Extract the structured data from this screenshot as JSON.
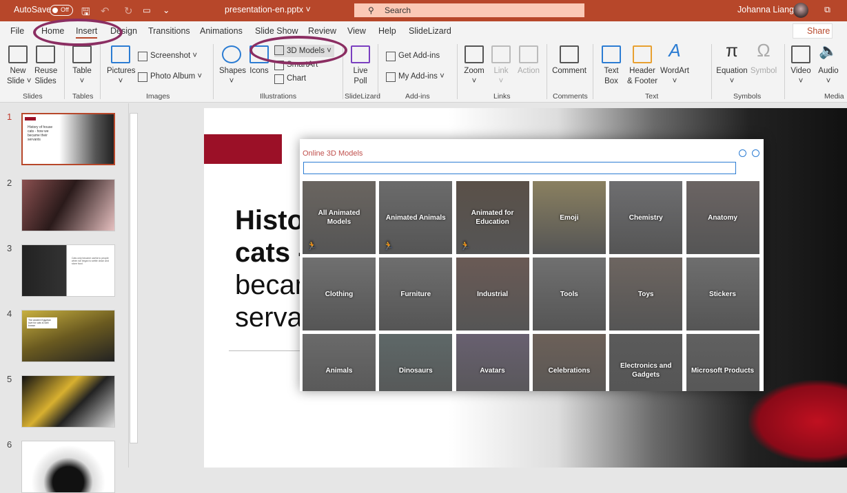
{
  "titlebar": {
    "autosave": "AutoSave",
    "toggle": "Off",
    "filename": "presentation-en.pptx ˅",
    "search": "Search",
    "user": "Johanna Liang"
  },
  "tabs": [
    "File",
    "Home",
    "Insert",
    "Design",
    "Transitions",
    "Animations",
    "Slide Show",
    "Review",
    "View",
    "Help",
    "SlideLizard"
  ],
  "active_tab": "Insert",
  "share": "Share",
  "ribbon": {
    "new_slide": "New\nSlide ˅",
    "reuse": "Reuse\nSlides",
    "table": "Table\n˅",
    "pictures": "Pictures\n˅",
    "screenshot": "Screenshot ˅",
    "photo_album": "Photo Album ˅",
    "shapes": "Shapes\n˅",
    "icons": "Icons",
    "models3d": "3D Models ˅",
    "smartart": "SmartArt",
    "chart": "Chart",
    "live_poll": "Live\nPoll",
    "get_addins": "Get Add-ins",
    "my_addins": "My Add-ins ˅",
    "zoom": "Zoom\n˅",
    "link": "Link\n˅",
    "action": "Action",
    "comment": "Comment",
    "textbox": "Text\nBox",
    "header": "Header\n& Footer",
    "wordart": "WordArt\n˅",
    "equation": "Equation\n˅",
    "symbol": "Symbol",
    "video": "Video\n˅",
    "audio": "Audio\n˅",
    "groups": [
      "Slides",
      "Tables",
      "Images",
      "Illustrations",
      "SlideLizard",
      "Add-ins",
      "Links",
      "Comments",
      "Text",
      "Symbols",
      "Media"
    ]
  },
  "slides": [
    {
      "n": "1",
      "text": "History of house cats - how we became their servants"
    },
    {
      "n": "2",
      "text": ""
    },
    {
      "n": "3",
      "text": "Cats only became useful to people when we began to settle down and store food."
    },
    {
      "n": "4",
      "text": "The ancient Egyptian love for cats is well known"
    },
    {
      "n": "5",
      "text": ""
    },
    {
      "n": "6",
      "text": ""
    }
  ],
  "slide": {
    "line1": "History of house",
    "line2": "cats - how we",
    "line3": "became their",
    "line4": "servants"
  },
  "dialog": {
    "title": "Online 3D Models",
    "search_value": "",
    "categories": [
      "All Animated Models",
      "Animated Animals",
      "Animated for Education",
      "Emoji",
      "Chemistry",
      "Anatomy",
      "Clothing",
      "Furniture",
      "Industrial",
      "Tools",
      "Toys",
      "Stickers",
      "Animals",
      "Dinosaurs",
      "Avatars",
      "Celebrations",
      "Electronics and Gadgets",
      "Microsoft Products"
    ],
    "animated": [
      true,
      true,
      true,
      false,
      false,
      false,
      false,
      false,
      false,
      false,
      false,
      false,
      false,
      false,
      false,
      false,
      false,
      false
    ]
  },
  "colors": {
    "brand": "#b7472a",
    "accent": "#2b7cd3",
    "highlight": "#8b2e62",
    "slide_red": "#9b1027"
  }
}
